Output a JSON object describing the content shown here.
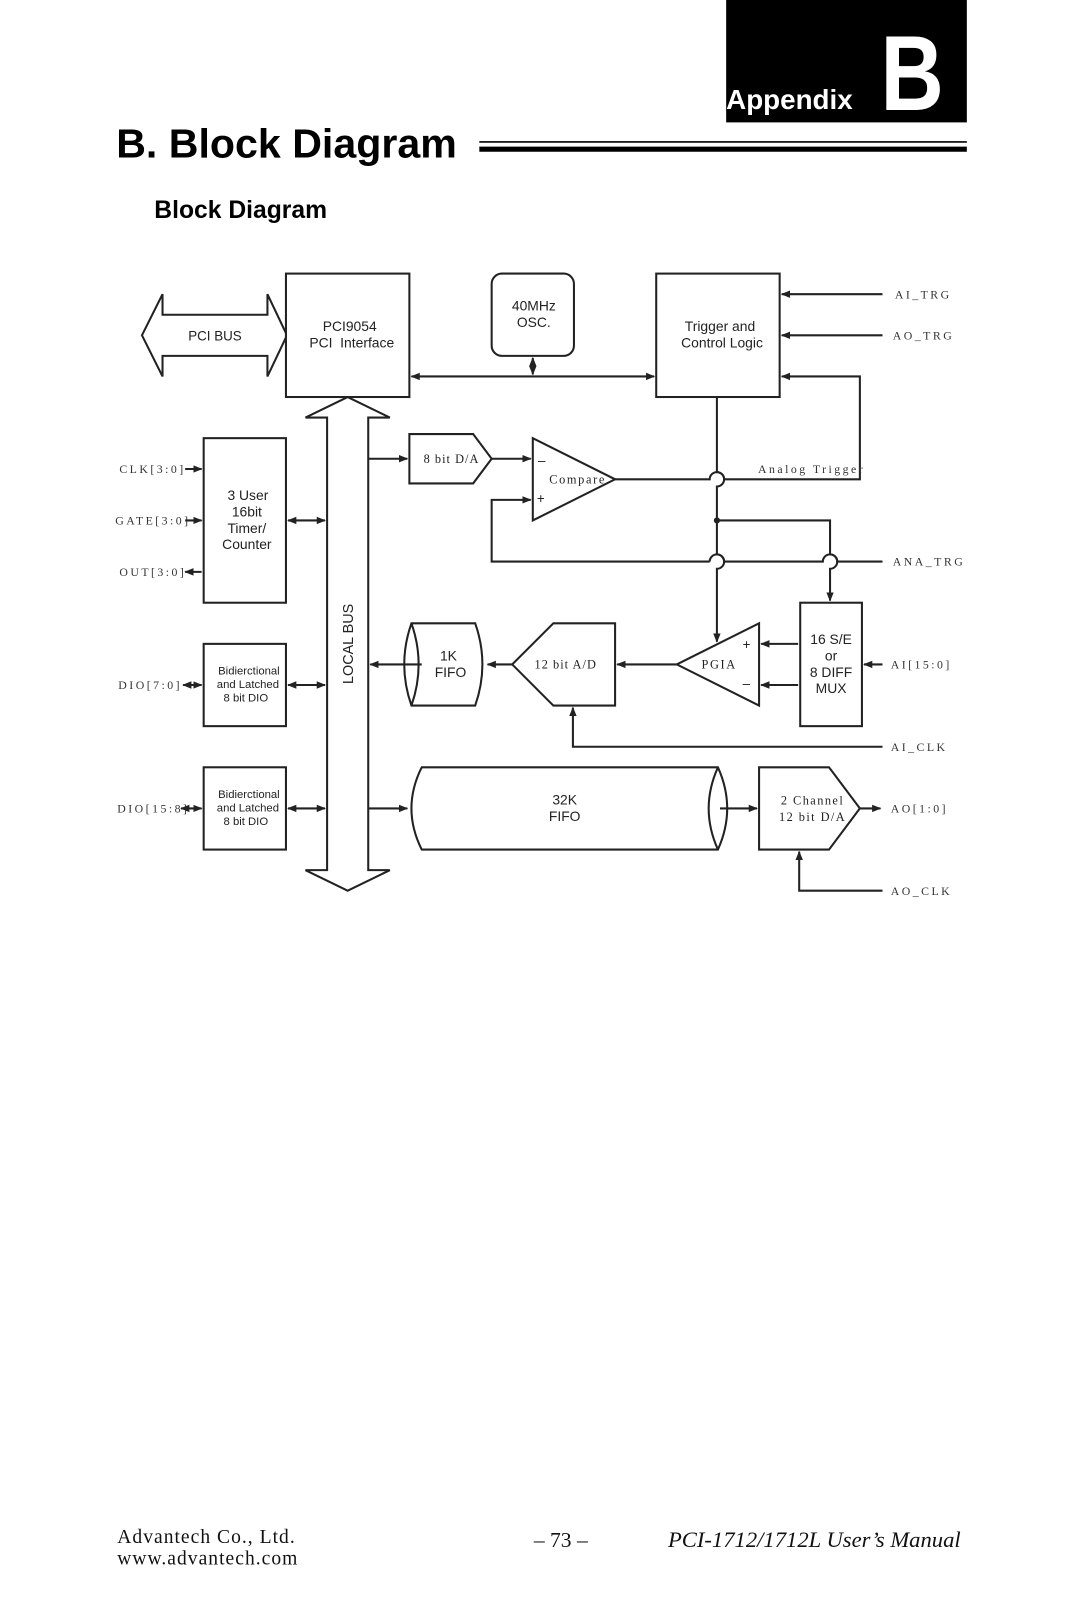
{
  "header": {
    "appendix_label": "Appendix",
    "appendix_letter": "B",
    "chapter_title": "B. Block Diagram",
    "section_title": "Block Diagram"
  },
  "diagram": {
    "pci_bus": "PCI BUS",
    "pci_interface": [
      "PCI9054",
      "PCI  Interface"
    ],
    "oscillator": [
      "40MHz",
      "OSC."
    ],
    "trigger_logic": [
      "Trigger and",
      "Control Logic"
    ],
    "timer": [
      "3 User",
      "16bit",
      "Timer/",
      "Counter"
    ],
    "dio_block_1": [
      "Bidierctional",
      "and Latched",
      "8 bit DIO"
    ],
    "dio_block_2": [
      "Bidierctional",
      "and Latched",
      "8 bit DIO"
    ],
    "local_bus": "LOCAL BUS",
    "dac_8bit": "8 bit D/A",
    "comparator": "Compare",
    "comparator_minus": "–",
    "comparator_plus": "+",
    "analog_trigger": "Analog Trigger",
    "fifo_1k": [
      "1K",
      "FIFO"
    ],
    "adc_12bit": "12 bit A/D",
    "pgia": "PGIA",
    "pgia_plus": "+",
    "pgia_minus": "–",
    "mux": [
      "16 S/E",
      "or",
      "8 DIFF",
      "MUX"
    ],
    "fifo_32k": [
      "32K",
      "FIFO"
    ],
    "dac_2ch": [
      "2 Channel",
      "12 bit D/A"
    ],
    "signals": {
      "ai_trg": "AI_TRG",
      "ao_trg": "AO_TRG",
      "ana_trg": "ANA_TRG",
      "ai_in": "AI[15:0]",
      "ai_clk": "AI_CLK",
      "ao_out": "AO[1:0]",
      "ao_clk": "AO_CLK",
      "clk": "CLK[3:0]",
      "gate": "GATE[3:0]",
      "out": "OUT[3:0]",
      "dio_low": "DIO[7:0]",
      "dio_high": "DIO[15:8]"
    }
  },
  "footer": {
    "company": "Advantech Co., Ltd.",
    "website": "www.advantech.com",
    "page_number": "– 73 –",
    "manual_title": "PCI-1712/1712L User’s Manual"
  }
}
